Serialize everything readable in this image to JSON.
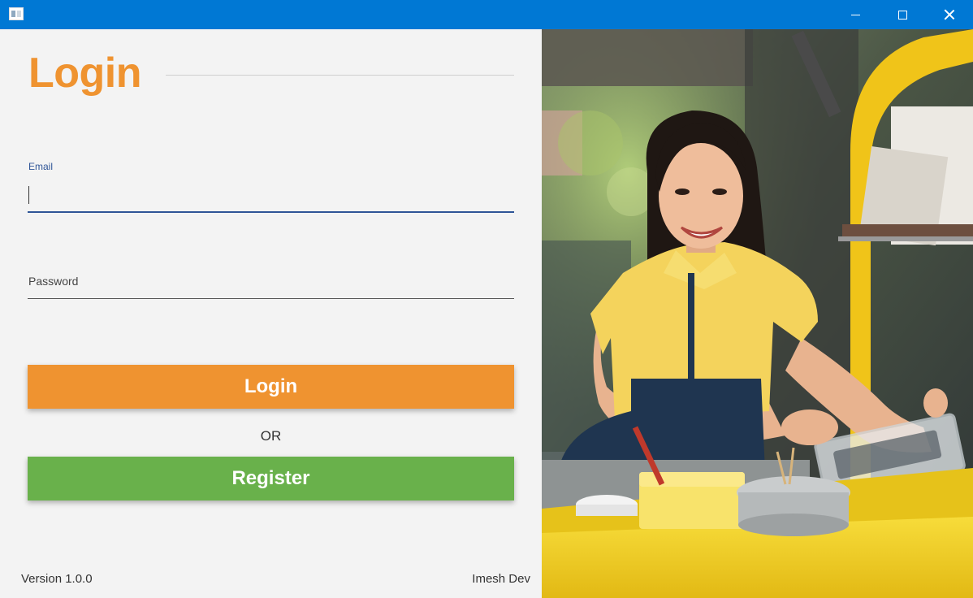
{
  "window": {
    "title": "",
    "controls": {
      "minimize_icon": "minimize-icon",
      "maximize_icon": "maximize-icon",
      "close_icon": "close-icon"
    }
  },
  "login_form": {
    "heading": "Login",
    "email": {
      "label": "Email",
      "value": ""
    },
    "password": {
      "label": "Password",
      "value": ""
    },
    "login_button": "Login",
    "separator": "OR",
    "register_button": "Register"
  },
  "footer": {
    "version": "Version 1.0.0",
    "author": "Imesh Dev"
  },
  "colors": {
    "titlebar": "#0078d4",
    "accent": "#ef9330",
    "register": "#69b14b",
    "focus": "#2f5597"
  }
}
